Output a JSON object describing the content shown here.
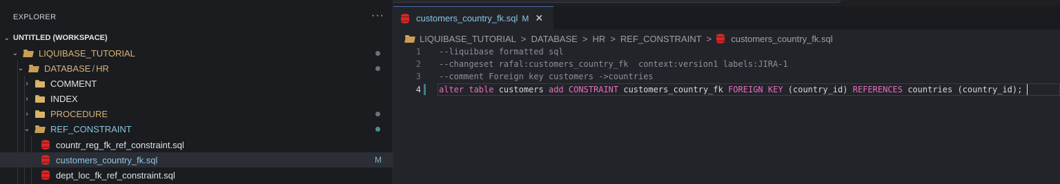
{
  "explorer": {
    "header": "EXPLORER",
    "more": "···",
    "workspace": "UNTITLED (WORKSPACE)",
    "tree": {
      "project": "LIQUIBASE_TUTORIAL",
      "database_folder": "DATABASE",
      "database_sep": "/",
      "hr_folder": "HR",
      "folders": [
        "COMMENT",
        "INDEX",
        "PROCEDURE"
      ],
      "ref_constraint": "REF_CONSTRAINT",
      "files": [
        "countr_reg_fk_ref_constraint.sql",
        "customers_country_fk.sql",
        "dept_loc_fk_ref_constraint.sql"
      ],
      "modified_badge": "M"
    }
  },
  "tab": {
    "label": "customers_country_fk.sql",
    "badge": "M",
    "close": "✕"
  },
  "breadcrumb": {
    "items": [
      "LIQUIBASE_TUTORIAL",
      "DATABASE",
      "HR",
      "REF_CONSTRAINT",
      "customers_country_fk.sql"
    ],
    "separator": ">"
  },
  "editor": {
    "line_numbers": [
      "1",
      "2",
      "3",
      "4"
    ],
    "lines": {
      "l1": "--liquibase formatted sql",
      "l2": "--changeset rafal:customers_country_fk  context:version1 labels:JIRA-1",
      "l3": "--comment Foreign key customers ->countries",
      "l4": {
        "alter_table": "alter table",
        "t1": " customers ",
        "add_constraint": "add CONSTRAINT",
        "t2": " customers_country_fk ",
        "foreign_key": "FOREIGN KEY",
        "t3": " (country_id) ",
        "references": "REFERENCES",
        "t4": " countries (country_id);"
      }
    }
  },
  "colors": {
    "keyword": "#e76ec0",
    "comment": "#8a8fa0",
    "folder": "#d9b46a",
    "sql_icon": "#d32828",
    "accent_text": "#84c8e6"
  }
}
